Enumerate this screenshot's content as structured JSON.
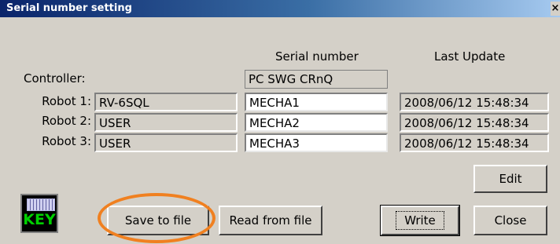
{
  "window": {
    "title": "Serial number setting",
    "close_glyph": "×"
  },
  "headers": {
    "serial_number": "Serial number",
    "last_update": "Last Update"
  },
  "controller": {
    "label": "Controller:",
    "serial": "PC SWG CRnQ"
  },
  "robots": [
    {
      "label": "Robot 1:",
      "model": "RV-6SQL",
      "serial": "MECHA1",
      "last_update": "2008/06/12 15:48:34"
    },
    {
      "label": "Robot 2:",
      "model": "USER",
      "serial": "MECHA2",
      "last_update": "2008/06/12 15:48:34"
    },
    {
      "label": "Robot 3:",
      "model": "USER",
      "serial": "MECHA3",
      "last_update": "2008/06/12 15:48:34"
    }
  ],
  "buttons": {
    "edit": "Edit",
    "save": "Save to file",
    "read": "Read from file",
    "write": "Write",
    "close": "Close"
  },
  "key_icon": {
    "text": "KEY",
    "icon": "keyboard-icon"
  },
  "colors": {
    "title_bar": "#0a246a",
    "highlight": "#f08020",
    "key_text": "#00d000"
  }
}
